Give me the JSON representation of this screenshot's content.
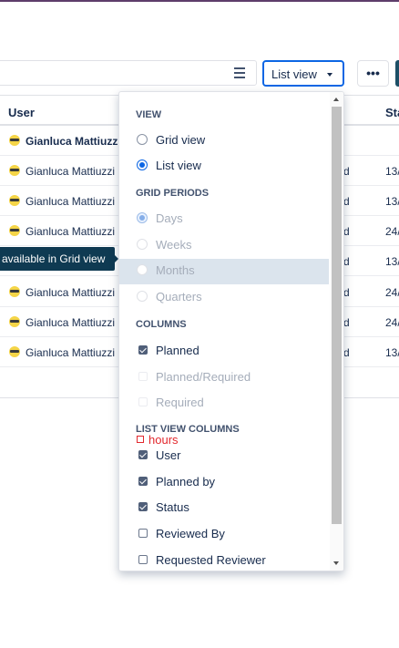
{
  "toolbar": {
    "view_select_label": "List view",
    "more_label": "•••"
  },
  "table": {
    "columns": {
      "user": "User",
      "status": "Sta"
    },
    "rows": [
      {
        "user": "Gianluca Mattiuzzi",
        "bold": true,
        "c": "",
        "date": ""
      },
      {
        "user": "Gianluca Mattiuzzi",
        "c": "d",
        "date": "13/"
      },
      {
        "user": "Gianluca Mattiuzzi",
        "c": "d",
        "date": "13/"
      },
      {
        "user": "Gianluca Mattiuzzi",
        "c": "d",
        "date": "24/"
      },
      {
        "user": "Gianluca Mattiuzzi",
        "c": "d",
        "date": "13/"
      },
      {
        "user": "Gianluca Mattiuzzi",
        "c": "d",
        "date": "24/"
      },
      {
        "user": "Gianluca Mattiuzzi",
        "c": "d",
        "date": "24/"
      },
      {
        "user": "Gianluca Mattiuzzi",
        "c": "d",
        "date": "13/"
      }
    ],
    "tooltip": "available in Grid view"
  },
  "dropdown": {
    "view_heading": "VIEW",
    "view_options": [
      {
        "label": "Grid view",
        "checked": false
      },
      {
        "label": "List view",
        "checked": true
      }
    ],
    "grid_periods_heading": "GRID PERIODS",
    "grid_periods": [
      {
        "label": "Days",
        "checked": true
      },
      {
        "label": "Weeks",
        "checked": false
      },
      {
        "label": "Months",
        "checked": false
      },
      {
        "label": "Quarters",
        "checked": false
      }
    ],
    "columns_heading": "COLUMNS",
    "columns": [
      {
        "label": "Planned",
        "checked": true,
        "disabled": false
      },
      {
        "label": "Planned/Required",
        "checked": false,
        "disabled": true
      },
      {
        "label": "Required",
        "checked": false,
        "disabled": true
      }
    ],
    "list_view_columns_heading": "LIST VIEW COLUMNS",
    "hours_annotation": "hours",
    "list_view_columns": [
      {
        "label": "User",
        "checked": true
      },
      {
        "label": "Planned by",
        "checked": true
      },
      {
        "label": "Status",
        "checked": true
      },
      {
        "label": "Reviewed By",
        "checked": false
      },
      {
        "label": "Requested Reviewer",
        "checked": false
      }
    ]
  }
}
